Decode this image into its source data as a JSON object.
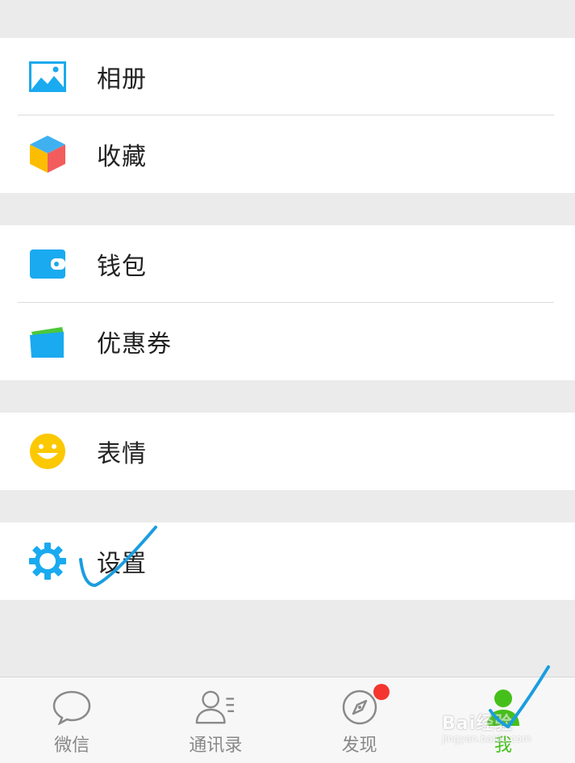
{
  "menu": {
    "album": {
      "label": "相册",
      "icon": "album-icon"
    },
    "favorites": {
      "label": "收藏",
      "icon": "favorites-cube-icon"
    },
    "wallet": {
      "label": "钱包",
      "icon": "wallet-icon"
    },
    "coupons": {
      "label": "优惠券",
      "icon": "coupon-card-icon"
    },
    "stickers": {
      "label": "表情",
      "icon": "smiley-icon"
    },
    "settings": {
      "label": "设置",
      "icon": "gear-icon"
    }
  },
  "tabbar": {
    "chats": {
      "label": "微信",
      "icon": "chat-bubble-icon"
    },
    "contacts": {
      "label": "通讯录",
      "icon": "contacts-icon"
    },
    "discover": {
      "label": "发现",
      "icon": "compass-icon",
      "badge": true
    },
    "me": {
      "label": "我",
      "icon": "person-icon",
      "active": true
    }
  },
  "watermark": {
    "text": "Bai经验",
    "sub": "jingyan.baidu.com"
  },
  "colors": {
    "accent_blue": "#1aaaf0",
    "active_green": "#45c01a",
    "badge_red": "#f43530",
    "annotation_blue": "#1a9de0"
  }
}
